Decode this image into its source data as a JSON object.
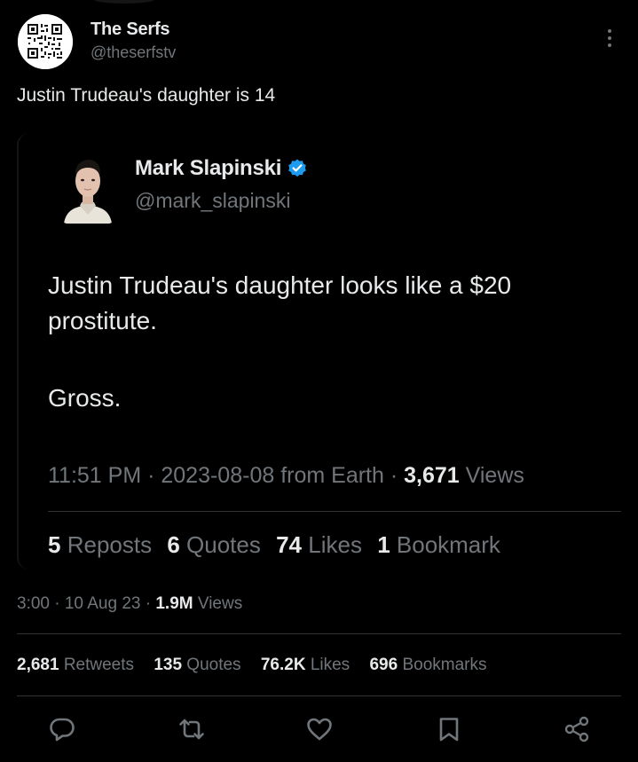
{
  "tweet": {
    "author": {
      "name": "The Serfs",
      "handle": "@theserfstv",
      "avatar": "qr-code-avatar"
    },
    "text": "Justin Trudeau's daughter is 14",
    "timestamp": "3:00 · 10 Aug 23 · ",
    "views_count": "1.9M",
    "views_label": " Views",
    "stats": {
      "retweets_count": "2,681",
      "retweets_label": "Retweets",
      "quotes_count": "135",
      "quotes_label": "Quotes",
      "likes_count": "76.2K",
      "likes_label": "Likes",
      "bookmarks_count": "696",
      "bookmarks_label": "Bookmarks"
    }
  },
  "quoted": {
    "author": {
      "name": "Mark Slapinski",
      "handle": "@mark_slapinski",
      "verified": true
    },
    "text_line1": "Justin Trudeau's daughter looks like a $20 prostitute.",
    "text_line2": "Gross.",
    "timestamp": "11:51 PM · 2023-08-08 from Earth · ",
    "views_count": "3,671",
    "views_label": " Views",
    "stats": {
      "reposts_count": "5",
      "reposts_label": "Reposts",
      "quotes_count": "6",
      "quotes_label": "Quotes",
      "likes_count": "74",
      "likes_label": "Likes",
      "bookmarks_count": "1",
      "bookmarks_label": "Bookmark"
    }
  },
  "actions": [
    "reply-icon",
    "retweet-icon",
    "like-icon",
    "bookmark-icon",
    "share-icon"
  ],
  "colors": {
    "background": "#000000",
    "text_primary": "#e7e9ea",
    "text_secondary": "#71767b",
    "divider": "#2f3336",
    "verified": "#1d9bf0"
  }
}
